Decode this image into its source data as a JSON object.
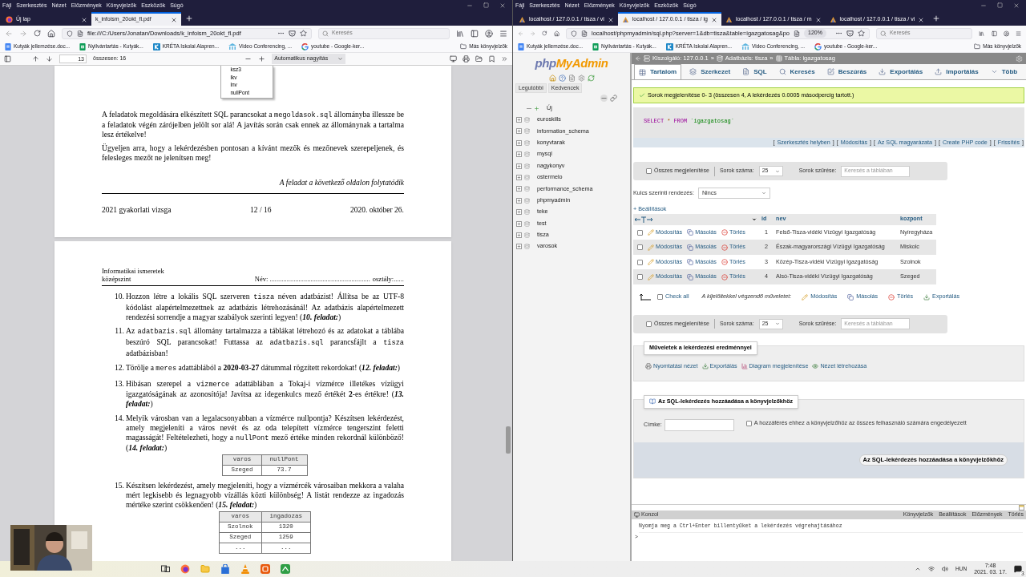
{
  "left_window": {
    "menu": [
      "Fájl",
      "Szerkesztés",
      "Nézet",
      "Előzmények",
      "Könyvjelzők",
      "Eszközök",
      "Súgó"
    ],
    "tabs": [
      {
        "label": "Új lap",
        "selected": false
      },
      {
        "label": "k_infoism_20okt_fl.pdf",
        "selected": true
      }
    ],
    "address": "file:///C:/Users/Jonatan/Downloads/k_infoism_20okt_fl.pdf",
    "search_placeholder": "Keresés",
    "bookmarks": [
      {
        "label": "Kutyák jellemzése.doc...",
        "kind": "doc"
      },
      {
        "label": "Nyilvántartás - Kutyák...",
        "kind": "sheet"
      },
      {
        "label": "KRÉTA Iskolai Alapren...",
        "kind": "kreta"
      },
      {
        "label": "Video Conferencing, ...",
        "kind": "video"
      },
      {
        "label": "youtube - Google-ker...",
        "kind": "google"
      }
    ],
    "other_bookmarks": "Más könyvjelzők",
    "pdf_toolbar": {
      "page": "13",
      "page_count": "összesen: 16",
      "zoom": "Automatikus nagyítás"
    },
    "pdf": {
      "listbox": [
        "ksz3",
        "lkv",
        "lnv",
        "nullPont"
      ],
      "paragraphs": [
        [
          {
            "text": "A feladatok megoldására elkészített SQL parancsokat a ",
            "kind": "plain"
          },
          {
            "text": "megoldasok.sql",
            "kind": "code"
          },
          {
            "text": " állományba illessze be a feladatok végén zárójelben jelölt sor alá! A javítás során csak ennek az állománynak a tartalma lesz értékelve!",
            "kind": "plain"
          }
        ],
        [
          {
            "text": "Ügyeljen arra, hogy a lekérdezésben pontosan a kívánt mezők és mezőnevek szerepeljenek, és felesleges mezőt ne jelenítsen meg!",
            "kind": "plain"
          }
        ]
      ],
      "continues": "A feladat a következő oldalon folytatódik",
      "footer": [
        "2021 gyakorlati vizsga",
        "12 / 16",
        "2020. október 26."
      ],
      "header_subject": "Informatikai ismeretek középszint",
      "header_name": "Név: ...........................................................",
      "header_class": "osztály:......",
      "tasks": [
        {
          "number": "10.",
          "segments": [
            {
              "text": "Hozzon létre a lokális SQL szerveren ",
              "kind": "plain"
            },
            {
              "text": "tisza",
              "kind": "code"
            },
            {
              "text": " néven adatbázist! Állítsa be az UTF-8 kódolást alapértelmezettnek az adatbázis létrehozásánál! Az adatbázis alapértelmezett rendezési sorrendje a magyar szabályok szerinti legyen! (",
              "kind": "plain"
            },
            {
              "text": "10. feladat:",
              "kind": "bolditalic"
            },
            {
              "text": ")",
              "kind": "plain"
            }
          ]
        },
        {
          "number": "11.",
          "segments": [
            {
              "text": "Az ",
              "kind": "plain"
            },
            {
              "text": "adatbazis.sql",
              "kind": "code"
            },
            {
              "text": " állomány tartalmazza a táblákat létrehozó és az adatokat a táblába beszúró SQL parancsokat! Futtassa az ",
              "kind": "plain"
            },
            {
              "text": "adatbazis.sql",
              "kind": "code"
            },
            {
              "text": " parancsfájlt a ",
              "kind": "plain"
            },
            {
              "text": "tisza",
              "kind": "code"
            },
            {
              "text": " adatbázisban!",
              "kind": "plain"
            }
          ]
        },
        {
          "number": "12.",
          "segments": [
            {
              "text": "Törölje a ",
              "kind": "plain"
            },
            {
              "text": "meres",
              "kind": "code"
            },
            {
              "text": " adattáblából a ",
              "kind": "plain"
            },
            {
              "text": "2020-03-27",
              "kind": "bold"
            },
            {
              "text": " dátummal rögzített rekordokat! (",
              "kind": "plain"
            },
            {
              "text": "12. feladat:",
              "kind": "bolditalic"
            },
            {
              "text": ")",
              "kind": "plain"
            }
          ]
        },
        {
          "number": "13.",
          "segments": [
            {
              "text": "Hibásan szerepel a ",
              "kind": "plain"
            },
            {
              "text": "vizmerce",
              "kind": "code"
            },
            {
              "text": " adattáblában a Tokaj-i vízmérce illetékes vízügyi igazgatóságának az azonosítója! Javítsa az idegenkulcs mező értékét ",
              "kind": "plain"
            },
            {
              "text": "2",
              "kind": "bold"
            },
            {
              "text": "-es értékre! (",
              "kind": "plain"
            },
            {
              "text": "13. feladat:",
              "kind": "bolditalic"
            },
            {
              "text": ")",
              "kind": "plain"
            }
          ]
        },
        {
          "number": "14.",
          "segments": [
            {
              "text": "Melyik városban van a legalacsonyabban a vízmérce nullpontja? Készítsen lekérdezést, amely megjeleníti a város nevét és az oda telepített vízmérce tengerszint feletti magasságát! Feltételezheti, hogy a ",
              "kind": "plain"
            },
            {
              "text": "nullPont",
              "kind": "code"
            },
            {
              "text": " mező értéke minden rekordnál különböző! (",
              "kind": "plain"
            },
            {
              "text": "14. feladat:",
              "kind": "bolditalic"
            },
            {
              "text": ")",
              "kind": "plain"
            }
          ],
          "table": {
            "columns": [
              "varos",
              "nullPont"
            ],
            "rows": [
              [
                "Szeged",
                "73.7"
              ]
            ]
          }
        },
        {
          "number": "15.",
          "segments": [
            {
              "text": "Készítsen lekérdezést, amely megjeleníti, hogy a vízmércék városaiban mekkora a valaha mért legkisebb és legnagyobb vízállás közti különbség! A listát rendezze az ingadozás mértéke szerint csökkenően! (",
              "kind": "plain"
            },
            {
              "text": "15. feladat:",
              "kind": "bolditalic"
            },
            {
              "text": ")",
              "kind": "plain"
            }
          ],
          "table": {
            "columns": [
              "varos",
              "ingadozas"
            ],
            "rows": [
              [
                "Szolnok",
                "1320"
              ],
              [
                "Szeged",
                "1259"
              ],
              [
                "...",
                "..."
              ]
            ]
          }
        }
      ]
    }
  },
  "right_window": {
    "menu": [
      "Fájl",
      "Szerkesztés",
      "Nézet",
      "Előzmények",
      "Könyvjelzők",
      "Eszközök",
      "Súgó"
    ],
    "tabs": [
      {
        "label": "localhost / 127.0.0.1 / tisza / vi",
        "selected": false
      },
      {
        "label": "localhost / 127.0.0.1 / tisza / ig",
        "selected": true
      },
      {
        "label": "localhost / 127.0.0.1 / tisza / m",
        "selected": false
      },
      {
        "label": "localhost / 127.0.0.1 / tisza / vi",
        "selected": false
      }
    ],
    "address": "localhost/phpmyadmin/sql.php?server=1&db=tisza&table=igazgatosag&po",
    "zoom_badge": "120%",
    "search_placeholder": "Keresés",
    "bookmarks": [
      {
        "label": "Kutyák jellemzése.doc...",
        "kind": "doc"
      },
      {
        "label": "Nyilvántartás - Kutyák...",
        "kind": "sheet"
      },
      {
        "label": "KRÉTA Iskolai Alapren...",
        "kind": "kreta"
      },
      {
        "label": "Video Conferencing, ...",
        "kind": "video"
      },
      {
        "label": "youtube - Google-ker...",
        "kind": "google"
      }
    ],
    "other_bookmarks": "Más könyvjelzők",
    "pma": {
      "logo_php": "php",
      "logo_myadmin": "MyAdmin",
      "nav_tabs": [
        "Legutóbbi",
        "Kedvencek"
      ],
      "tree": [
        {
          "label": "Új",
          "kind": "new"
        },
        {
          "label": "euroskills",
          "kind": "db"
        },
        {
          "label": "information_schema",
          "kind": "db"
        },
        {
          "label": "konyvtarak",
          "kind": "db"
        },
        {
          "label": "mysql",
          "kind": "db"
        },
        {
          "label": "nagykonyv",
          "kind": "db"
        },
        {
          "label": "ostermelo",
          "kind": "db"
        },
        {
          "label": "performance_schema",
          "kind": "db"
        },
        {
          "label": "phpmyadmin",
          "kind": "db"
        },
        {
          "label": "teke",
          "kind": "db"
        },
        {
          "label": "test",
          "kind": "db"
        },
        {
          "label": "tisza",
          "kind": "db"
        },
        {
          "label": "varosok",
          "kind": "db"
        }
      ],
      "breadcrumb": [
        {
          "label": "Kiszolgáló: 127.0.0.1",
          "kind": "server",
          "separator": "»"
        },
        {
          "label": "Adatbázis: tisza",
          "kind": "database",
          "separator": "»"
        },
        {
          "label": "Tábla: igazgatosag",
          "kind": "table"
        }
      ],
      "tabs": [
        {
          "label": "Tartalom",
          "kind": "browse",
          "selected": true
        },
        {
          "label": "Szerkezet",
          "kind": "structure",
          "selected": false
        },
        {
          "label": "SQL",
          "kind": "sql",
          "selected": false
        },
        {
          "label": "Keresés",
          "kind": "search",
          "selected": false
        },
        {
          "label": "Beszúrás",
          "kind": "insert",
          "selected": false
        },
        {
          "label": "Exportálás",
          "kind": "export",
          "selected": false
        },
        {
          "label": "Importálás",
          "kind": "import",
          "selected": false
        },
        {
          "label": "Több",
          "kind": "more",
          "selected": false
        }
      ],
      "message": "Sorok megjelenítése 0- 3 (összesen 4, A lekérdezés 0.0005 másodpercig tartott.)",
      "sql": [
        {
          "text": "SELECT",
          "kind": "keyword"
        },
        {
          "text": "*",
          "kind": "operator"
        },
        {
          "text": "FROM",
          "kind": "keyword"
        },
        {
          "text": "`igazgatosag`",
          "kind": "identifier"
        }
      ],
      "sql_links": [
        {
          "open": "[",
          "label": "Szerkesztés helyben",
          "close": "]"
        },
        {
          "open": "[",
          "label": "Módosítás",
          "close": "]"
        },
        {
          "open": "[",
          "label": "Az SQL magyarázata",
          "close": "]"
        },
        {
          "open": "[",
          "label": "Create PHP code",
          "close": "]"
        },
        {
          "open": "[",
          "label": "Frissítés",
          "close": "]"
        }
      ],
      "navbars": [
        {
          "show_all": "Összes megjelenítése",
          "checked": false,
          "rows_label": "Sorok száma:",
          "rows_value": "25",
          "filter_label": "Sorok szűrése:",
          "filter_placeholder": "Keresés a táblában"
        },
        {
          "show_all": "Összes megjelenítése",
          "checked": false,
          "rows_label": "Sorok száma:",
          "rows_value": "25",
          "filter_label": "Sorok szűrése:",
          "filter_placeholder": "Keresés a táblában"
        }
      ],
      "sort_label": "Kulcs szerinti rendezés:",
      "sort_value": "Nincs",
      "options_link": "+ Beállítások",
      "columns": [
        "id",
        "nev",
        "kozpont"
      ],
      "rows": [
        {
          "checked": false,
          "actions": [
            {
              "label": "Módosítás",
              "kind": "edit"
            },
            {
              "label": "Másolás",
              "kind": "copy"
            },
            {
              "label": "Törlés",
              "kind": "delete"
            }
          ],
          "cells": [
            "1",
            "Felső-Tisza-vidéki Vízügyi Igazgatóság",
            "Nyíregyháza"
          ]
        },
        {
          "checked": false,
          "actions": [
            {
              "label": "Módosítás",
              "kind": "edit"
            },
            {
              "label": "Másolás",
              "kind": "copy"
            },
            {
              "label": "Törlés",
              "kind": "delete"
            }
          ],
          "cells": [
            "2",
            "Észak-magyarországi Vízügyi Igazgatóság",
            "Miskolc"
          ]
        },
        {
          "checked": false,
          "actions": [
            {
              "label": "Módosítás",
              "kind": "edit"
            },
            {
              "label": "Másolás",
              "kind": "copy"
            },
            {
              "label": "Törlés",
              "kind": "delete"
            }
          ],
          "cells": [
            "3",
            "Közép-Tisza-vidéki Vízügyi Igazgatóság",
            "Szolnok"
          ]
        },
        {
          "checked": false,
          "actions": [
            {
              "label": "Módosítás",
              "kind": "edit"
            },
            {
              "label": "Másolás",
              "kind": "copy"
            },
            {
              "label": "Törlés",
              "kind": "delete"
            }
          ],
          "cells": [
            "4",
            "Alsó-Tisza-vidéki Vízügyi Igazgatóság",
            "Szeged"
          ]
        }
      ],
      "bulk": {
        "check_all": "Check all",
        "checked": false,
        "label": "A kijelöltekkel végzendő műveletet:",
        "actions": [
          {
            "label": "Módosítás",
            "kind": "edit"
          },
          {
            "label": "Másolás",
            "kind": "copy"
          },
          {
            "label": "Törlés",
            "kind": "delete"
          },
          {
            "label": "Exportálás",
            "kind": "export"
          }
        ]
      },
      "query_ops": {
        "title": "Műveletek a lekérdezési eredménnyel",
        "items": [
          {
            "label": "Nyomtatási nézet",
            "kind": "print"
          },
          {
            "label": "Exportálás",
            "kind": "export"
          },
          {
            "label": "Diagram megjelenítése",
            "kind": "chart"
          },
          {
            "label": "Nézet létrehozása",
            "kind": "view"
          }
        ]
      },
      "bookmark": {
        "title": "Az SQL-lekérdezés hozzáadása a könyvjelzőkhöz",
        "label_field": "Címke:",
        "share_label": "A hozzáférés ehhez a könyvjelzőhöz az összes felhasználó számára engedélyezett",
        "share_checked": false,
        "button": "Az SQL-lekérdezés hozzáadása a könyvjelzőkhöz"
      },
      "console": {
        "title": "Konzol",
        "links": [
          "Könyvjelzők",
          "Beállítások",
          "Előzmények",
          "Törlés"
        ],
        "hint": "Nyomja meg a Ctrl+Enter billentyűket a lekérdezés végrehajtásához",
        "prompt": ">"
      }
    }
  },
  "taskbar": {
    "apps": [
      {
        "kind": "taskview"
      },
      {
        "kind": "firefox"
      },
      {
        "kind": "folder"
      },
      {
        "kind": "store"
      },
      {
        "kind": "cone"
      },
      {
        "kind": "orange"
      },
      {
        "kind": "green"
      }
    ],
    "language": "HUN",
    "time": "7:48",
    "date": "2021. 03. 17.",
    "notifications": "3"
  }
}
